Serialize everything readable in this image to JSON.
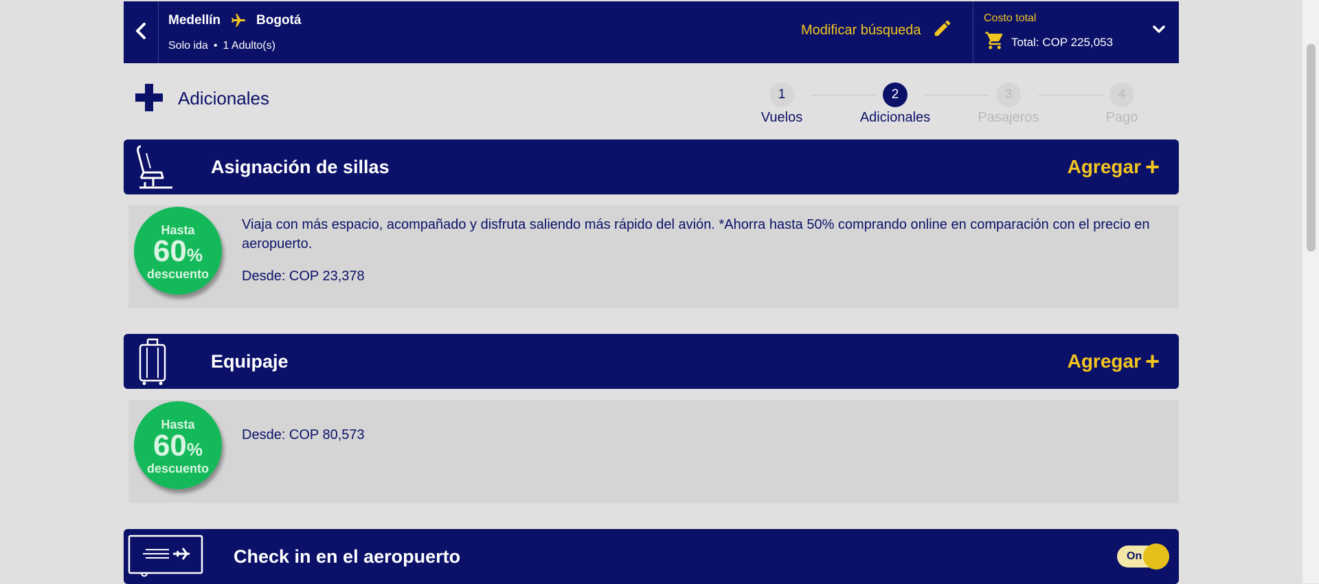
{
  "header": {
    "origin": "Medellín",
    "destination": "Bogotá",
    "trip_type": "Solo ida",
    "passengers": "1 Adulto(s)",
    "modify_label": "Modificar búsqueda",
    "cart_title": "Costo total",
    "cart_total": "Total: COP 225,053"
  },
  "section": {
    "title": "Adicionales"
  },
  "steps": [
    {
      "number": "1",
      "label": "Vuelos",
      "state": "done"
    },
    {
      "number": "2",
      "label": "Adicionales",
      "state": "active"
    },
    {
      "number": "3",
      "label": "Pasajeros",
      "state": "todo"
    },
    {
      "number": "4",
      "label": "Pago",
      "state": "todo"
    }
  ],
  "badge": {
    "line1": "Hasta",
    "line2": "60",
    "percent": "%",
    "line3": "descuento"
  },
  "cards": {
    "seats": {
      "title": "Asignación de sillas",
      "add_label": "Agregar",
      "description": "Viaja con más espacio, acompañado y disfruta saliendo más rápido del avión. *Ahorra hasta 50% comprando online en comparación con el precio en aeropuerto.",
      "price": "Desde: COP 23,378"
    },
    "luggage": {
      "title": "Equipaje",
      "add_label": "Agregar",
      "price": "Desde: COP 80,573"
    },
    "checkin": {
      "title": "Check in en el aeropuerto",
      "toggle_label": "On"
    }
  },
  "colors": {
    "brand_navy": "#0b1168",
    "accent_yellow": "#f2c51f",
    "badge_green": "#14b95a"
  },
  "icons": {
    "back": "chevron-left-icon",
    "plane": "airplane-icon",
    "edit": "pencil-icon",
    "cart": "cart-icon",
    "expand": "chevron-down-icon",
    "add_section": "plus-icon",
    "seat": "seat-icon",
    "luggage": "suitcase-icon",
    "checkin": "boarding-pass-icon"
  }
}
